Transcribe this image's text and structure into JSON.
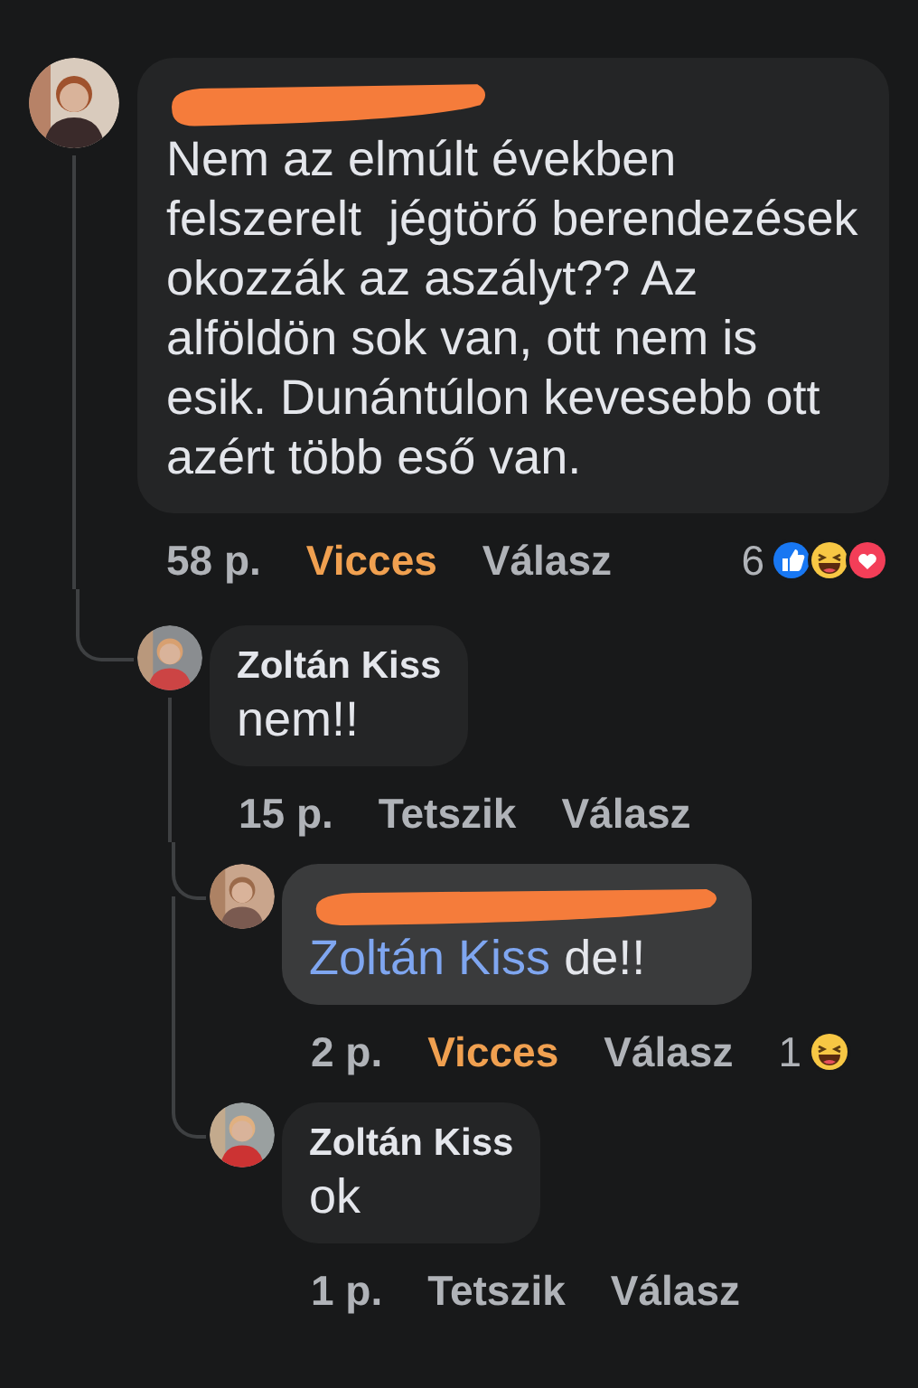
{
  "comments": [
    {
      "author_redacted": true,
      "highlighted": false,
      "text": "Nem az elmúlt években felszerelt  jégtörő berendezések okozzák az aszályt?? Az alföldön sok van, ott nem is esik. Dunántúlon kevesebb ott azért több eső van.",
      "time": "58 p.",
      "react": {
        "label": "Vicces",
        "reacted": true
      },
      "reply": "Válasz",
      "reactions": {
        "count": "6",
        "icons": [
          {
            "kind": "like"
          },
          {
            "kind": "haha"
          },
          {
            "kind": "love"
          }
        ]
      },
      "children": [
        {
          "author": "Zoltán Kiss",
          "author_redacted": false,
          "highlighted": false,
          "text": "nem!!",
          "time": "15 p.",
          "react": {
            "label": "Tetszik",
            "reacted": false
          },
          "reply": "Válasz",
          "children": [
            {
              "author_redacted": true,
              "highlighted": true,
              "mention": "Zoltán Kiss",
              "text": "de!!",
              "time": "2 p.",
              "react": {
                "label": "Vicces",
                "reacted": true
              },
              "reply": "Válasz",
              "reactions": {
                "count": "1",
                "icons": [
                  {
                    "kind": "haha"
                  }
                ]
              }
            },
            {
              "author": "Zoltán Kiss",
              "author_redacted": false,
              "highlighted": false,
              "text": "ok",
              "time": "1 p.",
              "react": {
                "label": "Tetszik",
                "reacted": false
              },
              "reply": "Válasz"
            }
          ]
        }
      ]
    }
  ]
}
